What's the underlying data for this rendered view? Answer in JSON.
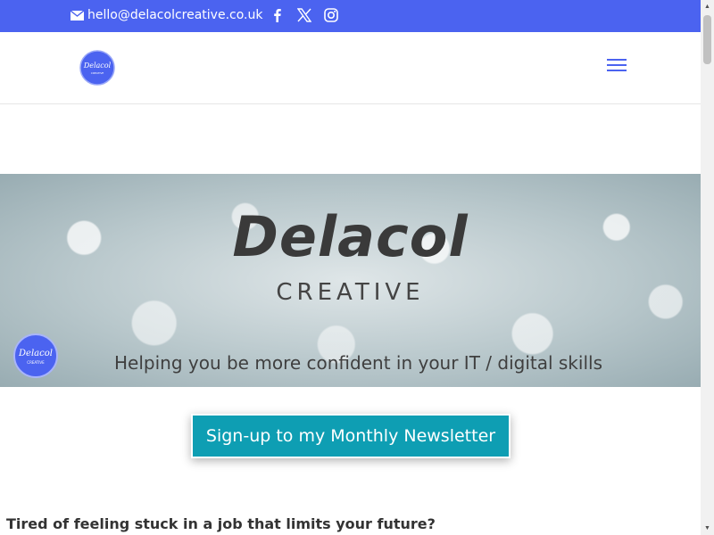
{
  "topbar": {
    "email": "hello@delacolcreative.co.uk",
    "icons": [
      "mail-icon",
      "facebook-icon",
      "x-icon",
      "instagram-icon"
    ],
    "color": "#4b63f0"
  },
  "header": {
    "logo_text": "Delacol",
    "logo_subtext": "CREATIVE",
    "menu_icon": "hamburger-menu-icon"
  },
  "hero": {
    "title": "Delacol",
    "subtitle": "CREATIVE",
    "tagline": "Helping you be more confident in your IT / digital skills",
    "badge_text": "Delacol",
    "badge_subtext": "CREATIVE"
  },
  "cta": {
    "label": "Sign-up to my Monthly Newsletter",
    "color": "#0e9eb3"
  },
  "content": {
    "heading": "Tired of feeling stuck in a job that limits your future?"
  }
}
